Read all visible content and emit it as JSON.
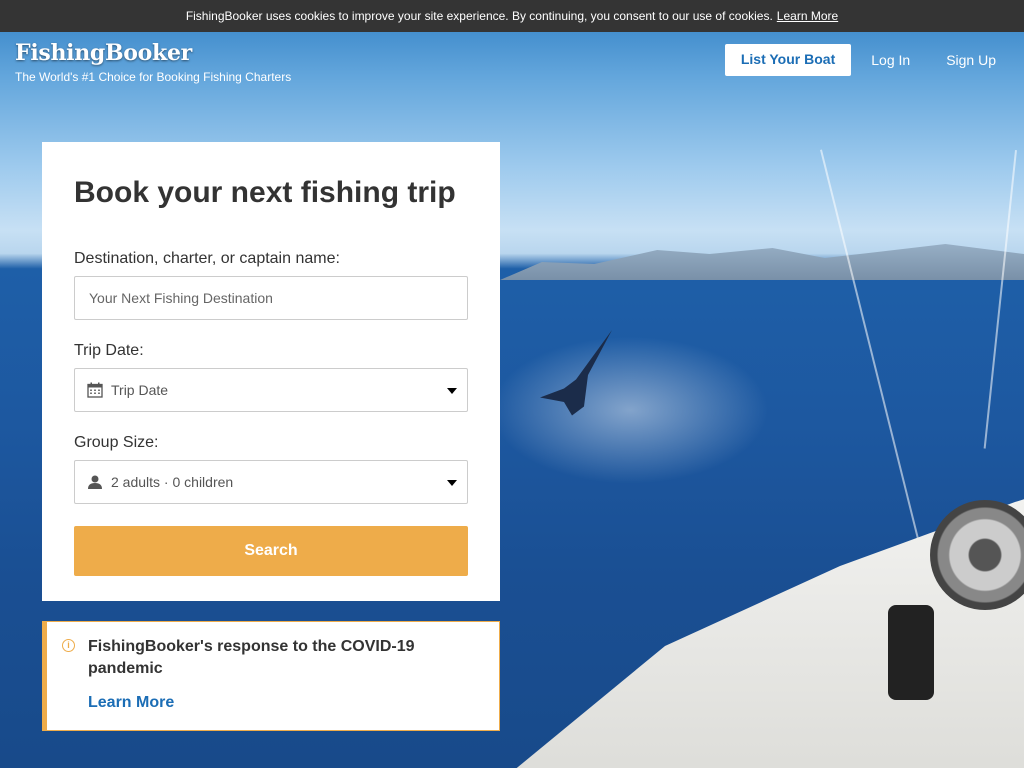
{
  "cookie_bar": {
    "message": "FishingBooker uses cookies to improve your site experience. By continuing, you consent to our use of cookies.",
    "link": "Learn More"
  },
  "header": {
    "logo": "FishingBooker",
    "tagline": "The World's #1 Choice for Booking Fishing Charters",
    "nav": {
      "list_boat": "List Your Boat",
      "log_in": "Log In",
      "sign_up": "Sign Up"
    }
  },
  "booking": {
    "title": "Book your next fishing trip",
    "destination_label": "Destination, charter, or captain name:",
    "destination_placeholder": "Your Next Fishing Destination",
    "date_label": "Trip Date:",
    "date_value": "Trip Date",
    "group_label": "Group Size:",
    "group_value": "2 adults · 0 children",
    "search_button": "Search"
  },
  "notice": {
    "title": "FishingBooker's response to the COVID-19 pandemic",
    "link": "Learn More"
  },
  "colors": {
    "accent": "#eeac4a",
    "link_blue": "#1b6db5",
    "cookie_bar_bg": "#343434"
  },
  "icons": [
    "info-icon",
    "calendar-icon",
    "user-icon",
    "chevron-down-icon"
  ]
}
